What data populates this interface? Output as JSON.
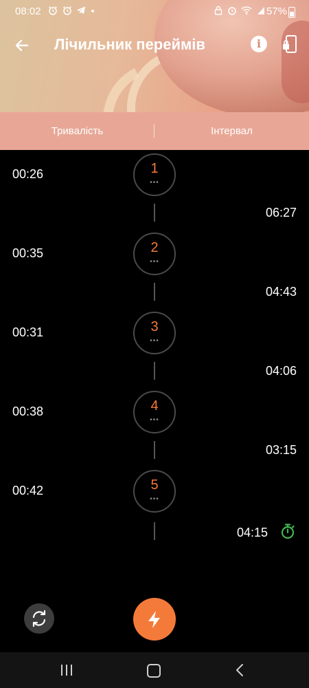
{
  "status_bar": {
    "time": "08:02",
    "battery": "57%",
    "left_icons": [
      "alarm-icon",
      "alarm-icon",
      "telegram-icon",
      "dot"
    ],
    "right_icons": [
      "lock-icon",
      "alarm-icon",
      "wifi-icon",
      "signal-icon",
      "battery-icon"
    ]
  },
  "app_bar": {
    "title": "Лічильник переймів",
    "back_icon": "arrow-left-icon",
    "info_icon": "info-icon",
    "phone_icon": "phone-lock-icon"
  },
  "tabs": {
    "duration": "Тривалість",
    "interval": "Інтервал"
  },
  "contractions": [
    {
      "number": "1",
      "duration": "00:26",
      "interval": "06:27"
    },
    {
      "number": "2",
      "duration": "00:35",
      "interval": "04:43"
    },
    {
      "number": "3",
      "duration": "00:31",
      "interval": "04:06"
    },
    {
      "number": "4",
      "duration": "00:38",
      "interval": "03:15"
    },
    {
      "number": "5",
      "duration": "00:42",
      "interval": ""
    }
  ],
  "current_interval": "04:15",
  "controls": {
    "reset_icon": "sync-icon",
    "start_icon": "lightning-icon"
  },
  "colors": {
    "accent": "#f47a3a",
    "tab_bar": "#e8a796",
    "timer_green": "#3fb950",
    "circle_border": "#4a4a4a"
  }
}
